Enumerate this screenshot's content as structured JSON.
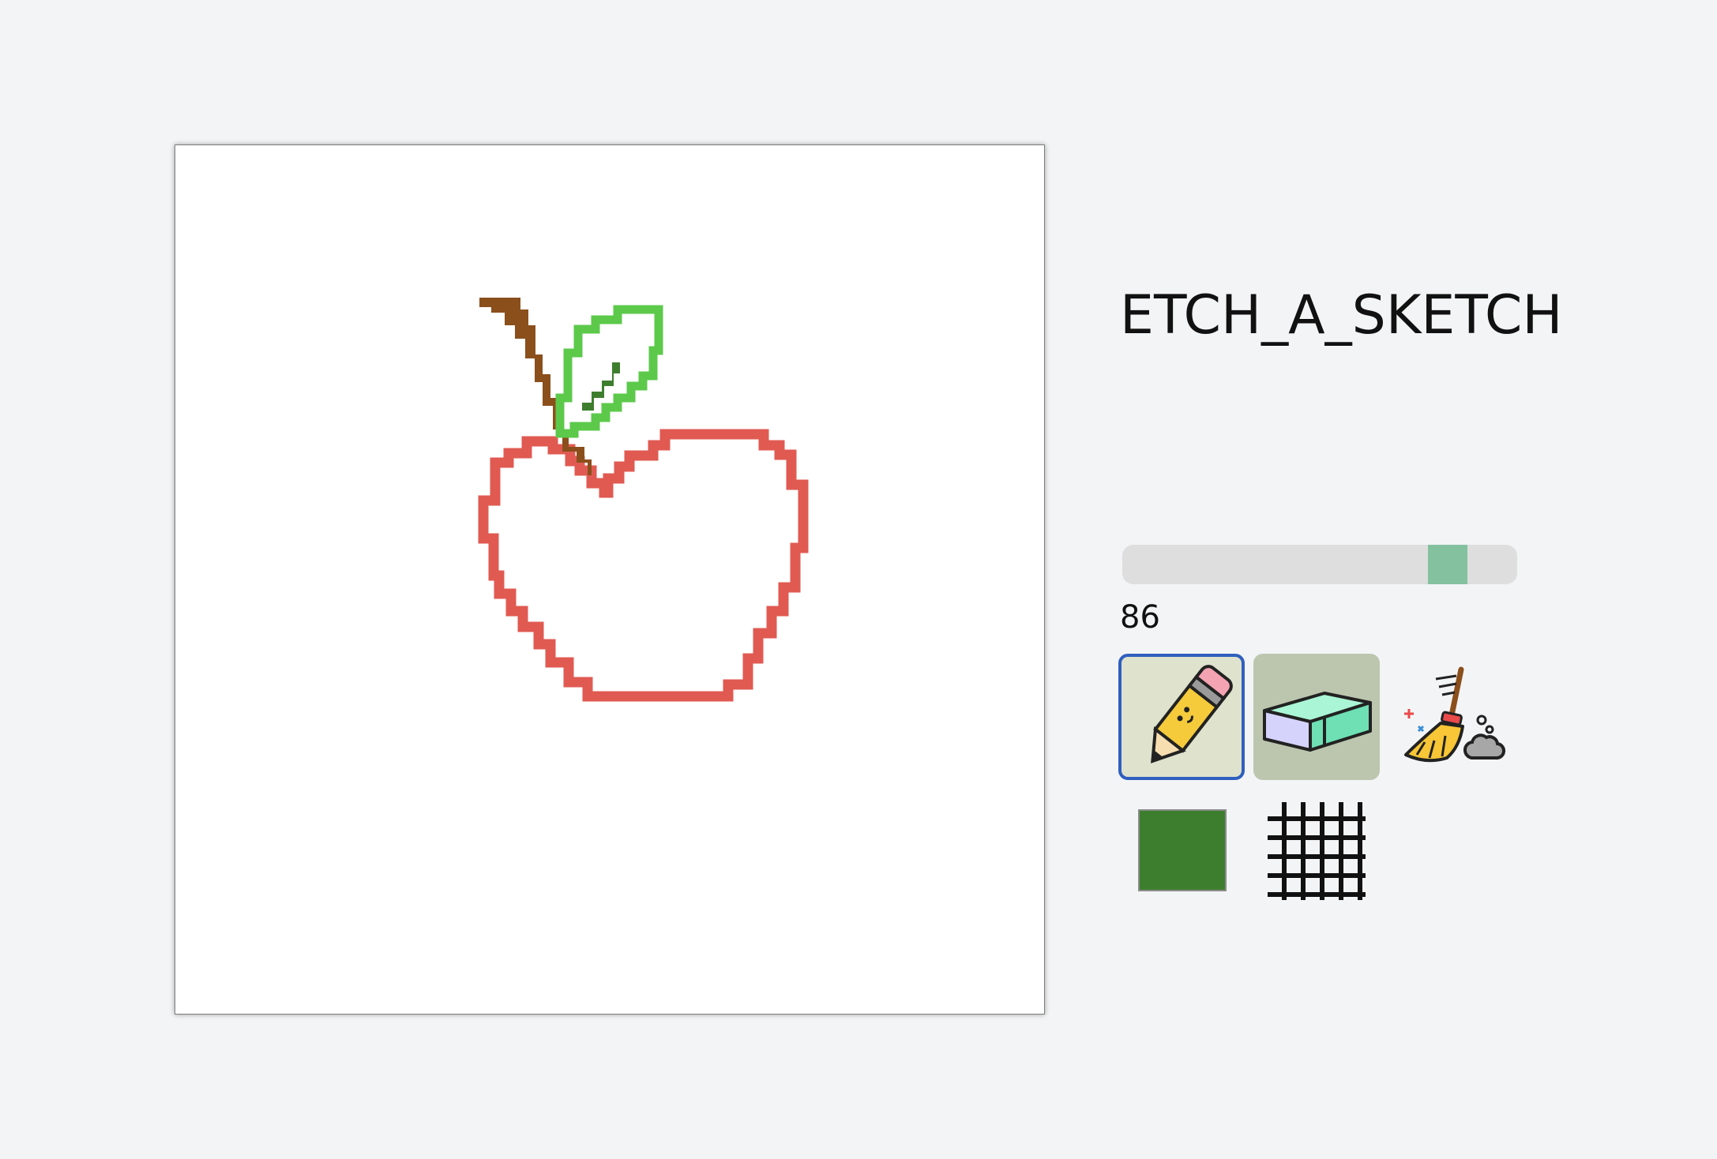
{
  "app": {
    "title": "ETCH_A_SKETCH"
  },
  "controls": {
    "grid_size_value": "86",
    "grid_size_fraction": 0.86,
    "active_tool": "pencil",
    "current_color": "#3d7e2e",
    "grid_lines_enabled": true
  },
  "tools": [
    {
      "name": "pencil",
      "icon": "pencil-icon",
      "active": true
    },
    {
      "name": "eraser",
      "icon": "eraser-icon",
      "active": false
    },
    {
      "name": "clear",
      "icon": "broom-icon",
      "active": false
    }
  ],
  "drawing": {
    "subject": "apple",
    "colors": {
      "apple_outline": "#e05a52",
      "stem": "#8b4f1c",
      "leaf_outline": "#5cc94b",
      "leaf_vein": "#3d7e2e"
    }
  }
}
